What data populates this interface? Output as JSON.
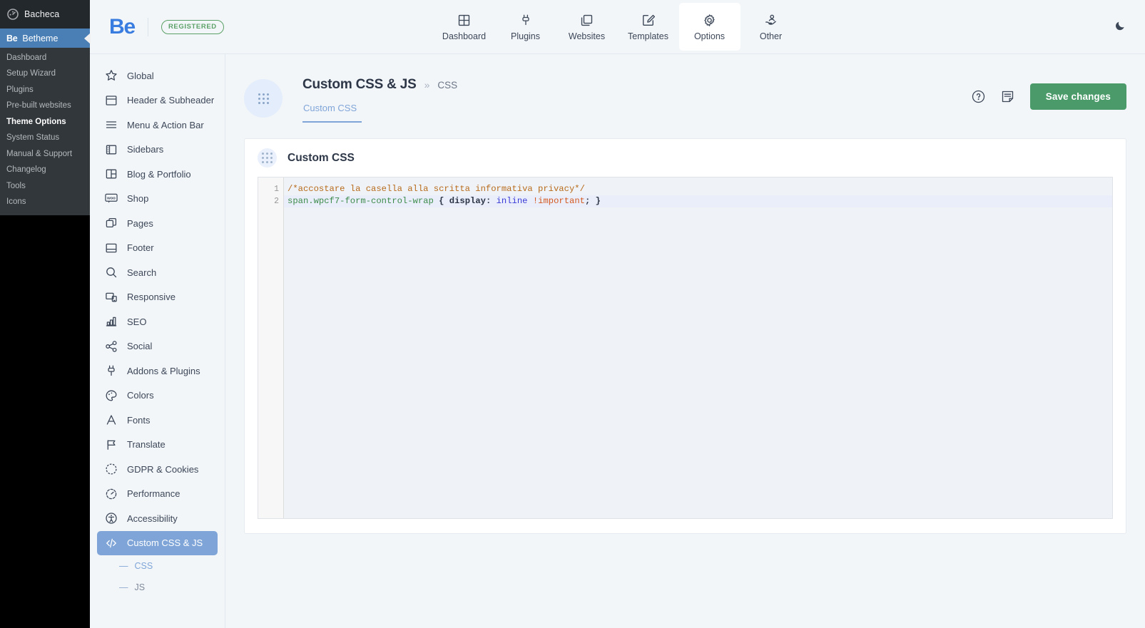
{
  "wp_sidebar": {
    "top_item": {
      "label": "Bacheca",
      "icon": "gauge-icon"
    },
    "current_item": {
      "mark": "Be",
      "label": "Betheme"
    },
    "submenu": [
      {
        "label": "Dashboard",
        "active": false
      },
      {
        "label": "Setup Wizard",
        "active": false
      },
      {
        "label": "Plugins",
        "active": false
      },
      {
        "label": "Pre-built websites",
        "active": false
      },
      {
        "label": "Theme Options",
        "active": true
      },
      {
        "label": "System Status",
        "active": false
      },
      {
        "label": "Manual & Support",
        "active": false
      },
      {
        "label": "Changelog",
        "active": false
      },
      {
        "label": "Tools",
        "active": false
      },
      {
        "label": "Icons",
        "active": false
      }
    ]
  },
  "topbar": {
    "logo_text": "Be",
    "badge": "REGISTERED",
    "badge_color": "#5ba167",
    "dark_mode_icon": "moon-icon",
    "nav": [
      {
        "label": "Dashboard",
        "icon": "grid-icon",
        "active": false
      },
      {
        "label": "Plugins",
        "icon": "plug-icon",
        "active": false
      },
      {
        "label": "Websites",
        "icon": "copy-icon",
        "active": false
      },
      {
        "label": "Templates",
        "icon": "edit-page-icon",
        "active": false
      },
      {
        "label": "Options",
        "icon": "gear-icon",
        "active": true
      },
      {
        "label": "Other",
        "icon": "hand-user-icon",
        "active": false
      }
    ]
  },
  "options_sidebar": {
    "items": [
      {
        "label": "Global",
        "icon": "star-icon",
        "active": false
      },
      {
        "label": "Header & Subheader",
        "icon": "header-layout-icon",
        "active": false
      },
      {
        "label": "Menu & Action Bar",
        "icon": "menu-lines-icon",
        "active": false
      },
      {
        "label": "Sidebars",
        "icon": "sidebar-layout-icon",
        "active": false
      },
      {
        "label": "Blog & Portfolio",
        "icon": "columns-layout-icon",
        "active": false
      },
      {
        "label": "Shop",
        "icon": "woo-icon",
        "active": false
      },
      {
        "label": "Pages",
        "icon": "pages-icon",
        "active": false
      },
      {
        "label": "Footer",
        "icon": "footer-layout-icon",
        "active": false
      },
      {
        "label": "Search",
        "icon": "search-icon",
        "active": false
      },
      {
        "label": "Responsive",
        "icon": "responsive-icon",
        "active": false
      },
      {
        "label": "SEO",
        "icon": "bar-chart-icon",
        "active": false
      },
      {
        "label": "Social",
        "icon": "share-icon",
        "active": false
      },
      {
        "label": "Addons & Plugins",
        "icon": "plug-icon",
        "active": false
      },
      {
        "label": "Colors",
        "icon": "palette-icon",
        "active": false
      },
      {
        "label": "Fonts",
        "icon": "letter-a-icon",
        "active": false
      },
      {
        "label": "Translate",
        "icon": "flag-icon",
        "active": false
      },
      {
        "label": "GDPR & Cookies",
        "icon": "cookie-icon",
        "active": false
      },
      {
        "label": "Performance",
        "icon": "speed-icon",
        "active": false
      },
      {
        "label": "Accessibility",
        "icon": "accessibility-icon",
        "active": false
      },
      {
        "label": "Custom CSS & JS",
        "icon": "code-icon",
        "active": true
      }
    ],
    "subitems": [
      {
        "label": "CSS",
        "active": true
      },
      {
        "label": "JS",
        "active": false
      }
    ],
    "active_color": "#7fa5d8"
  },
  "page_header": {
    "title": "Custom CSS & JS",
    "separator": "»",
    "breadcrumb": "CSS",
    "tabs": [
      {
        "label": "Custom CSS",
        "active": true
      }
    ],
    "help_icon": "question-circle-icon",
    "notes_icon": "note-icon",
    "save_label": "Save changes",
    "save_color": "#4a9a6a"
  },
  "panel": {
    "title": "Custom CSS",
    "drag_icon": "grip-dots-icon"
  },
  "editor": {
    "line_numbers": [
      "1",
      "2"
    ],
    "lines": [
      {
        "active": false,
        "tokens": [
          {
            "text": "/*accostare la casella alla scritta informativa privacy*/",
            "cls": "c-comment"
          }
        ]
      },
      {
        "active": true,
        "tokens": [
          {
            "text": "span.wpcf7-form-control-wrap",
            "cls": "c-tag"
          },
          {
            "text": " { ",
            "cls": "c-punct"
          },
          {
            "text": "display:",
            "cls": "c-prop"
          },
          {
            "text": " ",
            "cls": "c-punct"
          },
          {
            "text": "inline",
            "cls": "c-val"
          },
          {
            "text": " ",
            "cls": "c-punct"
          },
          {
            "text": "!important",
            "cls": "c-imp"
          },
          {
            "text": "; }",
            "cls": "c-punct"
          }
        ]
      }
    ]
  }
}
